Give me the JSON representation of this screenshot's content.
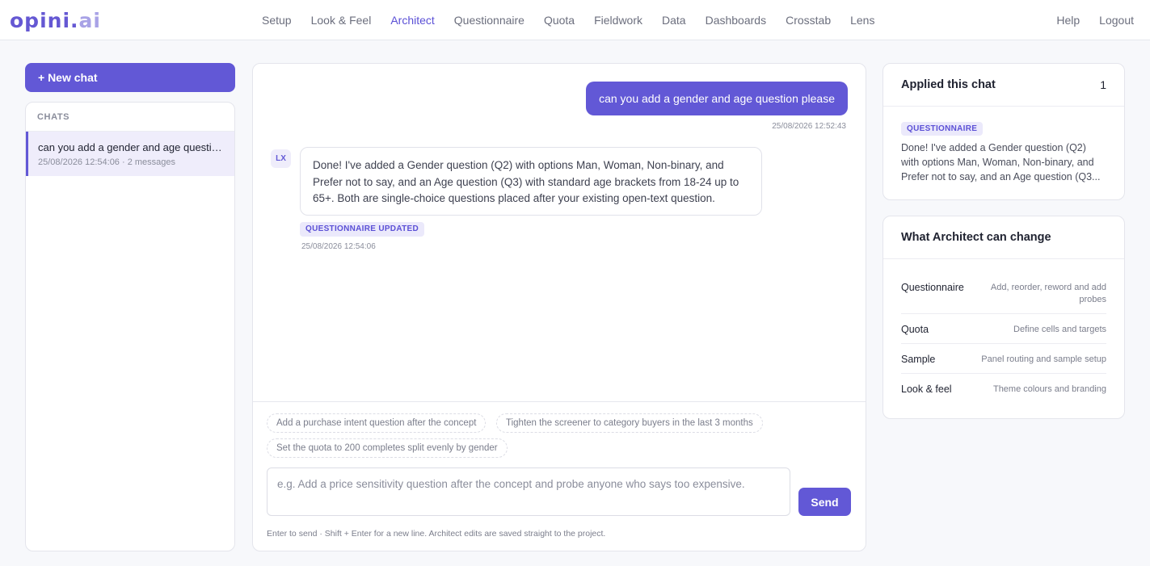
{
  "brand": {
    "logo_main": "opini.",
    "logo_suffix": "ai"
  },
  "nav": {
    "items": [
      {
        "label": "Setup"
      },
      {
        "label": "Look & Feel"
      },
      {
        "label": "Architect"
      },
      {
        "label": "Questionnaire"
      },
      {
        "label": "Quota"
      },
      {
        "label": "Fieldwork"
      },
      {
        "label": "Data"
      },
      {
        "label": "Dashboards"
      },
      {
        "label": "Crosstab"
      },
      {
        "label": "Lens"
      }
    ],
    "active": "Architect",
    "right": [
      {
        "label": "Help"
      },
      {
        "label": "Logout"
      }
    ]
  },
  "sidebar": {
    "new_chat_label": "+ New chat",
    "chats_heading": "CHATS",
    "chats": [
      {
        "title": "can you add a gender and age question please",
        "meta": "25/08/2026 12:54:06 · 2 messages"
      }
    ]
  },
  "conversation": {
    "user_message": "can you add a gender and age question please",
    "user_time": "25/08/2026 12:52:43",
    "bot_avatar": "LX",
    "bot_message": "Done! I've added a Gender question (Q2) with options Man, Woman, Non-binary, and Prefer not to say, and an Age question (Q3) with standard age brackets from 18-24 up to 65+. Both are single-choice questions placed after your existing open-text question.",
    "bot_badge": "QUESTIONNAIRE UPDATED",
    "bot_time": "25/08/2026 12:54:06"
  },
  "composer": {
    "suggestions": [
      "Add a purchase intent question after the concept",
      "Tighten the screener to category buyers in the last 3 months",
      "Set the quota to 200 completes split evenly by gender"
    ],
    "placeholder": "e.g. Add a price sensitivity question after the concept and probe anyone who says too expensive.",
    "send_label": "Send",
    "hint": "Enter to send · Shift + Enter for a new line. Architect edits are saved straight to the project."
  },
  "applied": {
    "title": "Applied this chat",
    "count": "1",
    "tag": "QUESTIONNAIRE",
    "text": "Done! I've added a Gender question (Q2) with options Man, Woman, Non-binary, and Prefer not to say, and an Age question (Q3..."
  },
  "capabilities": {
    "title": "What Architect can change",
    "items": [
      {
        "name": "Questionnaire",
        "desc": "Add, reorder, reword and add probes"
      },
      {
        "name": "Quota",
        "desc": "Define cells and targets"
      },
      {
        "name": "Sample",
        "desc": "Panel routing and sample setup"
      },
      {
        "name": "Look & feel",
        "desc": "Theme colours and branding"
      }
    ]
  },
  "colors": {
    "accent": "#6258d6",
    "accent_soft": "#efedfb",
    "text": "#1f2230",
    "muted": "#8a8d9b"
  }
}
